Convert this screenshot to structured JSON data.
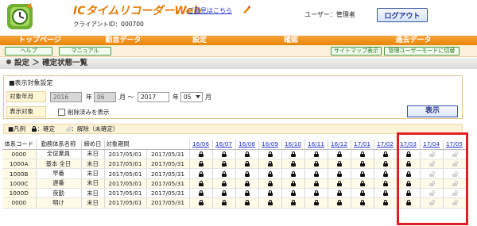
{
  "header": {
    "app_title": "ICタイムリコーダーWeb",
    "client_id": "クライアントID：000700",
    "feedback_link": "ご意見はこちら",
    "user_label": "ユーザー：管理者",
    "logout_label": "ログアウト"
  },
  "nav": {
    "items": [
      {
        "label": "トップページ"
      },
      {
        "label": "勤怠データ"
      },
      {
        "label": "設定"
      },
      {
        "label": "確認"
      },
      {
        "label": "過去データ"
      }
    ]
  },
  "subbar": {
    "help_label": "ヘルプ",
    "manual_label": "マニュアル",
    "sitemap_label": "サイトマップ表示",
    "admin_mode_label": "管理ユーザーモードに切替"
  },
  "breadcrumb": "設定 ＞ 確定状態一覧",
  "settings": {
    "title": "■表示対象設定",
    "month_label": "対象年月",
    "from_year": "2016",
    "year_unit": "年",
    "from_month": "06",
    "month_unit_tilde": "月 ～",
    "to_year": "2017",
    "to_month": "05",
    "month_unit": "月",
    "target_label": "表示対象",
    "include_deleted_label": "削除済みを表示",
    "show_button": "表示"
  },
  "legend": {
    "title": "■凡例",
    "confirmed": "：確定",
    "released": "：解除（未確定）"
  },
  "table": {
    "headers": [
      "体系コード",
      "勤務体系名称",
      "締め日",
      "対象期間"
    ],
    "months": [
      "16/06",
      "16/07",
      "16/08",
      "16/09",
      "16/10",
      "16/11",
      "16/12",
      "17/01",
      "17/02",
      "17/03",
      "17/04",
      "17/05"
    ],
    "rows": [
      {
        "code": "0000",
        "name": "全従業員",
        "close": "末日",
        "from": "2017/05/01",
        "to": "2017/05/31",
        "status": [
          "L",
          "L",
          "L",
          "L",
          "L",
          "L",
          "L",
          "L",
          "L",
          "L",
          "U",
          "U"
        ]
      },
      {
        "code": "1000A",
        "name": "基本 全日",
        "close": "末日",
        "from": "2017/05/01",
        "to": "2017/05/31",
        "status": [
          "L",
          "L",
          "L",
          "L",
          "L",
          "L",
          "L",
          "L",
          "L",
          "L",
          "U",
          "U"
        ]
      },
      {
        "code": "1000B",
        "name": "早番",
        "close": "末日",
        "from": "2017/05/01",
        "to": "2017/05/31",
        "status": [
          "L",
          "L",
          "L",
          "L",
          "L",
          "L",
          "L",
          "L",
          "L",
          "L",
          "U",
          "U"
        ]
      },
      {
        "code": "1000C",
        "name": "遅番",
        "close": "末日",
        "from": "2017/05/01",
        "to": "2017/05/31",
        "status": [
          "L",
          "L",
          "L",
          "L",
          "L",
          "L",
          "L",
          "L",
          "L",
          "L",
          "U",
          "U"
        ]
      },
      {
        "code": "1000D",
        "name": "夜勤",
        "close": "末日",
        "from": "2017/05/01",
        "to": "2017/05/31",
        "status": [
          "L",
          "L",
          "L",
          "L",
          "L",
          "L",
          "L",
          "L",
          "L",
          "L",
          "U",
          "U"
        ]
      },
      {
        "code": "0000",
        "name": "明け",
        "close": "末日",
        "from": "2017/05/01",
        "to": "2017/05/31",
        "status": [
          "L",
          "L",
          "L",
          "L",
          "L",
          "L",
          "L",
          "L",
          "L",
          "L",
          "U",
          "U"
        ]
      }
    ]
  },
  "colors": {
    "accent_orange": "#e88608",
    "link_blue": "#2233cc",
    "highlight_red": "#e02020"
  }
}
